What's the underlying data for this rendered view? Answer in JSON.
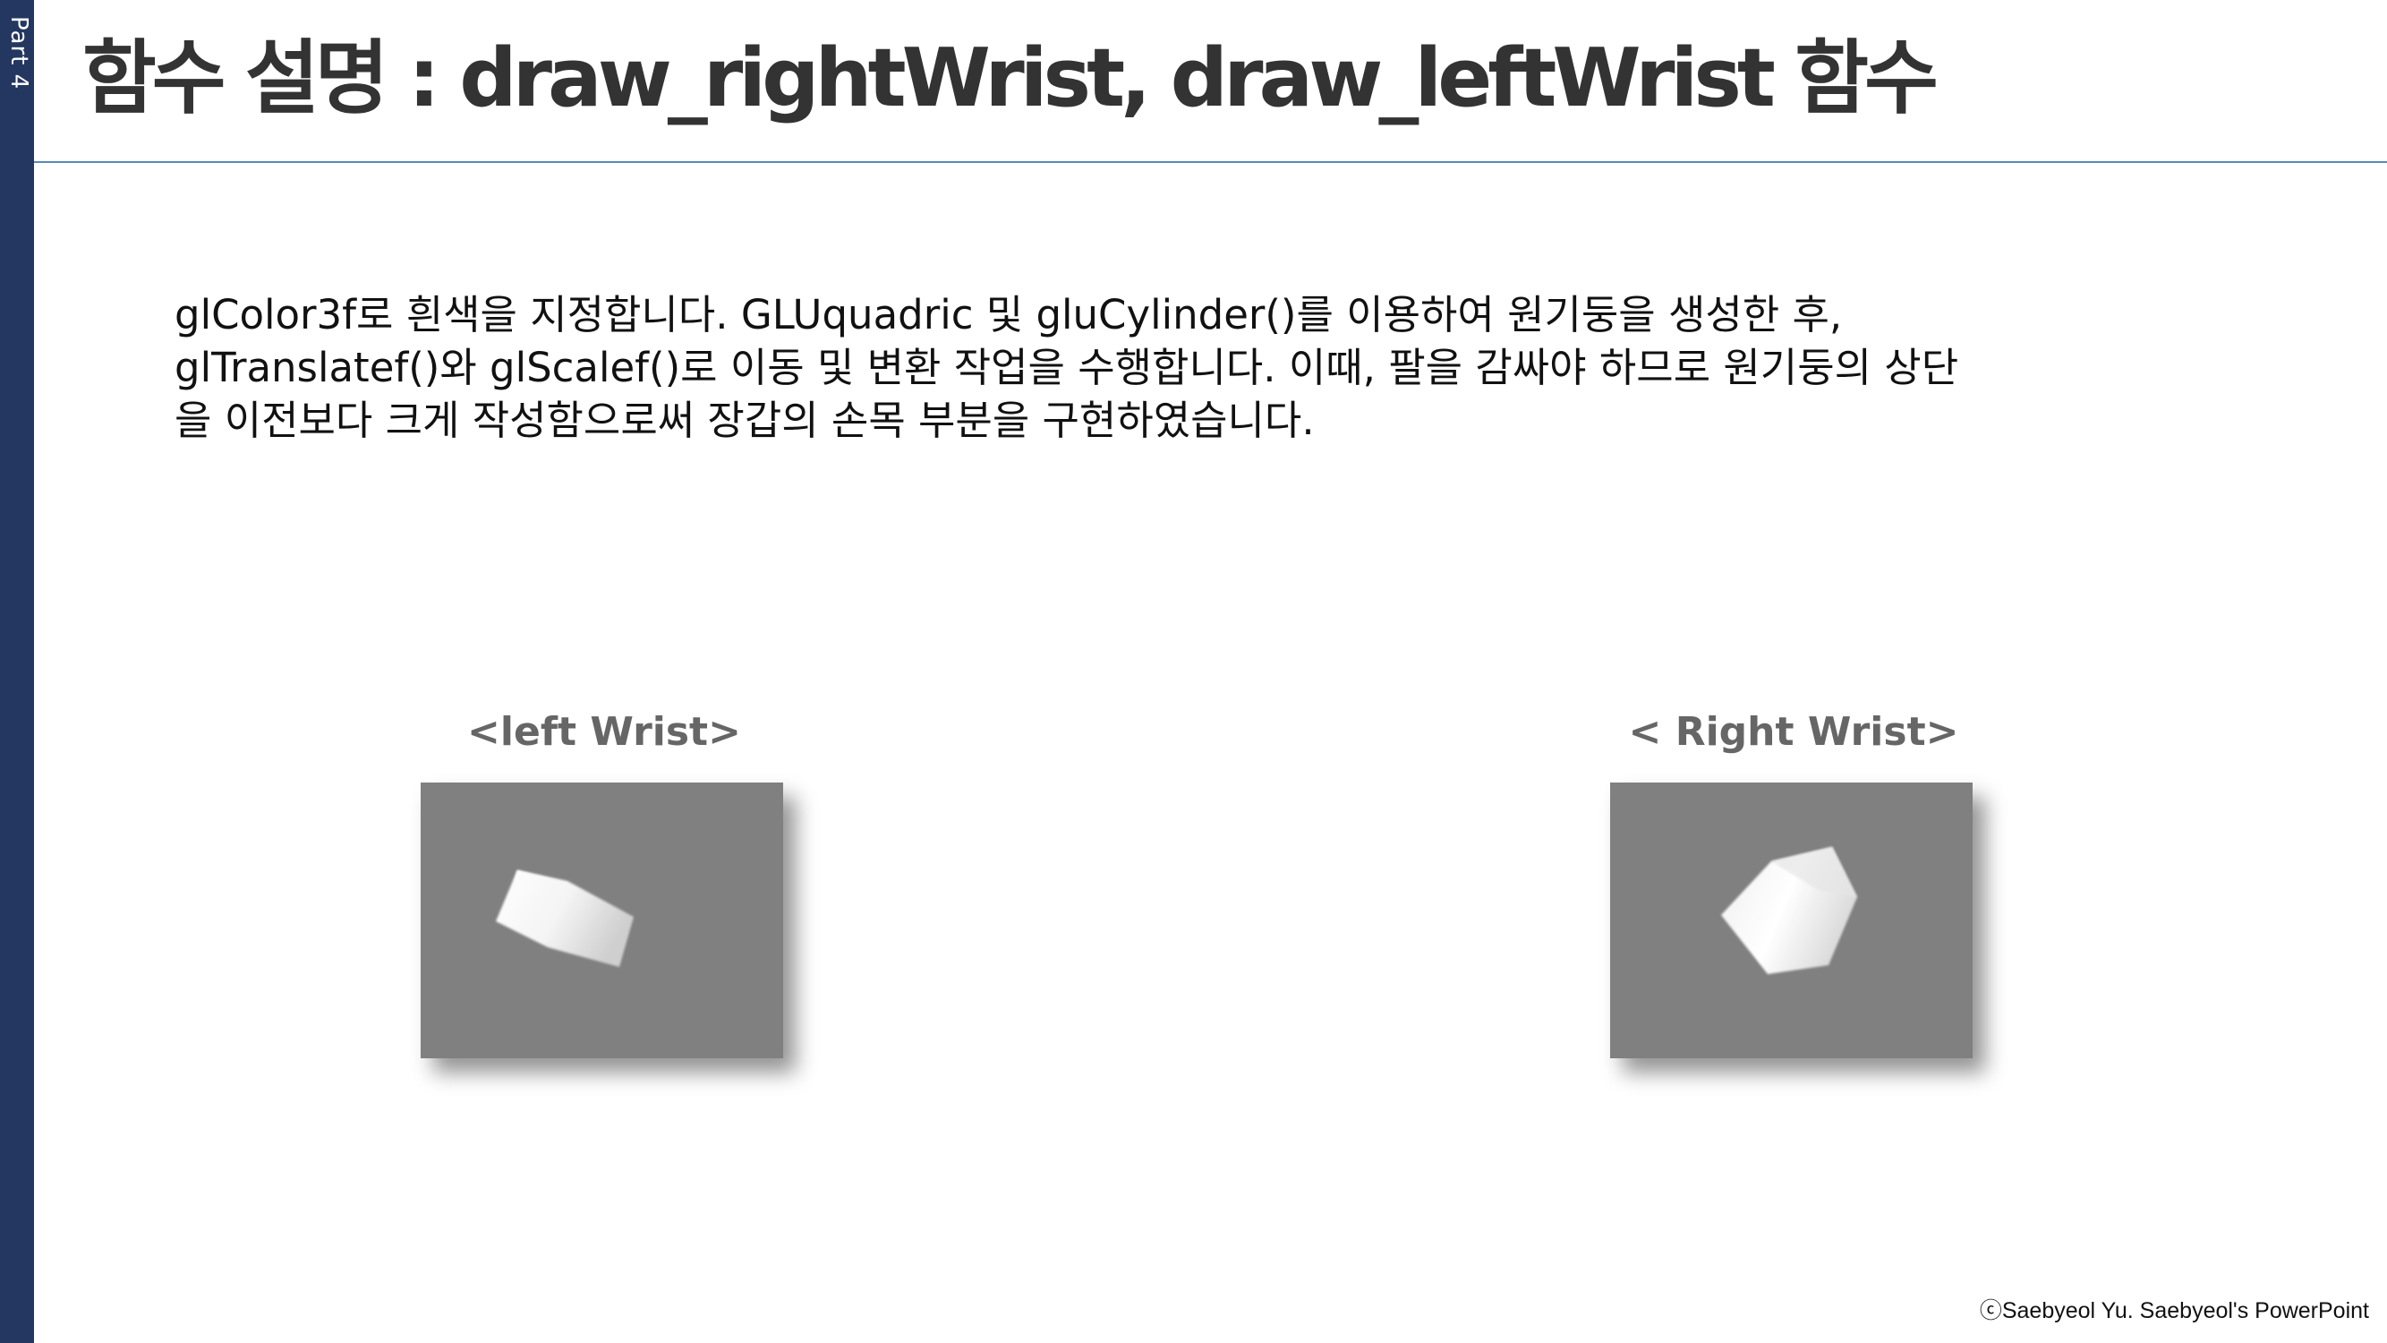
{
  "sidebar": {
    "label": "Part 4",
    "color": "#243760"
  },
  "header": {
    "title": "함수 설명 : draw_rightWrist, draw_leftWrist 함수"
  },
  "description": {
    "lines": [
      "glColor3f로 흰색을 지정합니다. GLUquadric 및 gluCylinder()를 이용하여 원기둥을 생성한 후,",
      "glTranslatef()와 glScalef()로 이동 및 변환 작업을 수행합니다. 이때, 팔을 감싸야 하므로 원기둥의 상단",
      "을 이전보다 크게 작성함으로써 장갑의 손목 부분을 구현하였습니다."
    ]
  },
  "figures": [
    {
      "caption": "<left Wrist>"
    },
    {
      "caption": "< Right Wrist>"
    }
  ],
  "colors": {
    "render_background": "#808080",
    "accent_rule": "#5b89b5"
  },
  "footer": {
    "copyright": "ⓒSaebyeol Yu. Saebyeol's PowerPoint"
  }
}
